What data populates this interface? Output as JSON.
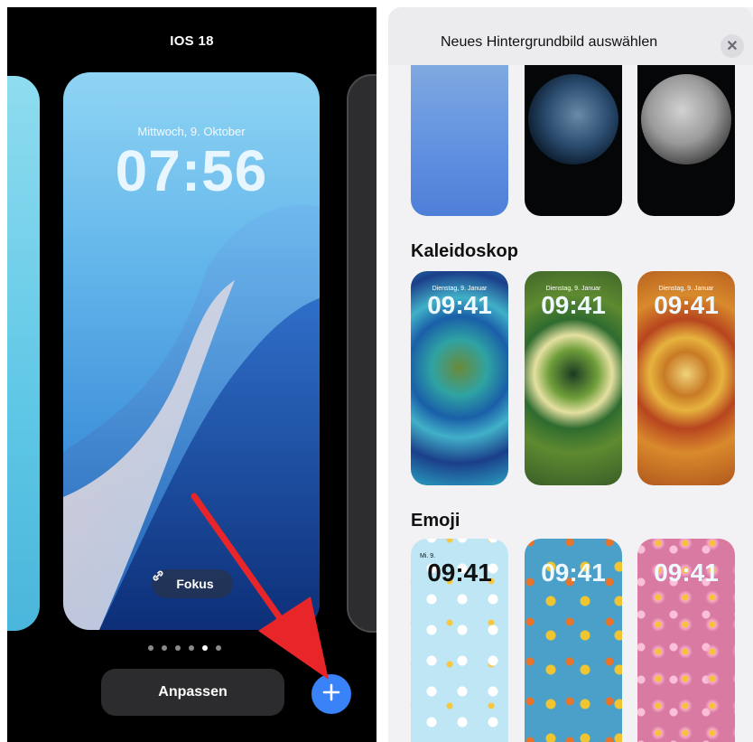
{
  "left": {
    "title": "IOS 18",
    "lock_date": "Mittwoch, 9. Oktober",
    "lock_time": "07:56",
    "focus_label": "Fokus",
    "page_dots": 6,
    "active_dot": 4,
    "customize_label": "Anpassen",
    "add_icon": "plus-icon",
    "colors": {
      "accent": "#3a82f7",
      "arrow": "#e8262a"
    }
  },
  "right": {
    "title": "Neues Hintergrundbild auswählen",
    "close_icon": "close-icon",
    "sections": [
      {
        "title": "Kaleidoskop"
      },
      {
        "title": "Emoji"
      }
    ],
    "thumb_time": "09:41",
    "thumb_date": "Dienstag, 9. Januar",
    "emoji_thumb_date": "Mi. 9."
  }
}
